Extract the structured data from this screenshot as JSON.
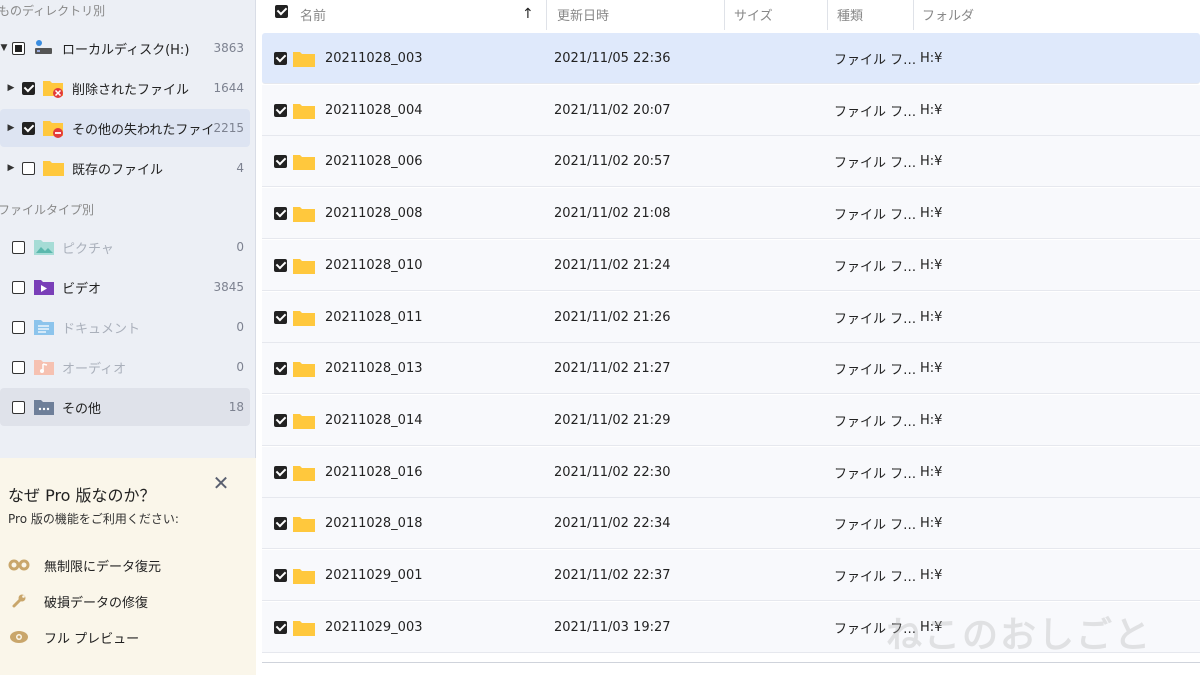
{
  "sidebar": {
    "dir_section_title": "ものディレクトリ別",
    "drive": {
      "label": "ローカルディスク(H:)",
      "count": "3863"
    },
    "dir_items": [
      {
        "label": "削除されたファイル",
        "count": "1644"
      },
      {
        "label": "その他の失われたファイル",
        "count": "2215"
      },
      {
        "label": "既存のファイル",
        "count": "4"
      }
    ],
    "type_section_title": "ファイルタイプ別",
    "type_items": [
      {
        "label": "ピクチャ",
        "count": "0",
        "icon": "picture-icon"
      },
      {
        "label": "ビデオ",
        "count": "3845",
        "icon": "video-icon"
      },
      {
        "label": "ドキュメント",
        "count": "0",
        "icon": "document-icon"
      },
      {
        "label": "オーディオ",
        "count": "0",
        "icon": "audio-icon"
      },
      {
        "label": "その他",
        "count": "18",
        "icon": "other-icon"
      }
    ]
  },
  "pro": {
    "title": "なぜ Pro 版なのか？",
    "subtitle": "Pro 版の機能をご利用ください:",
    "close": "✕",
    "features": [
      {
        "label": "無制限にデータ復元",
        "icon": "infinity-icon"
      },
      {
        "label": "破損データの修復",
        "icon": "wrench-icon"
      },
      {
        "label": "フル プレビュー",
        "icon": "eye-icon"
      }
    ]
  },
  "table": {
    "columns": {
      "name": "名前",
      "sort_arrow": "↑",
      "modified": "更新日時",
      "size": "サイズ",
      "type": "種類",
      "folder": "フォルダ"
    },
    "rows": [
      {
        "name": "20211028_003",
        "modified": "2021/11/05 22:36",
        "size": "",
        "type": "ファイル フ…",
        "folder": "H:¥"
      },
      {
        "name": "20211028_004",
        "modified": "2021/11/02 20:07",
        "size": "",
        "type": "ファイル フ…",
        "folder": "H:¥"
      },
      {
        "name": "20211028_006",
        "modified": "2021/11/02 20:57",
        "size": "",
        "type": "ファイル フ…",
        "folder": "H:¥"
      },
      {
        "name": "20211028_008",
        "modified": "2021/11/02 21:08",
        "size": "",
        "type": "ファイル フ…",
        "folder": "H:¥"
      },
      {
        "name": "20211028_010",
        "modified": "2021/11/02 21:24",
        "size": "",
        "type": "ファイル フ…",
        "folder": "H:¥"
      },
      {
        "name": "20211028_011",
        "modified": "2021/11/02 21:26",
        "size": "",
        "type": "ファイル フ…",
        "folder": "H:¥"
      },
      {
        "name": "20211028_013",
        "modified": "2021/11/02 21:27",
        "size": "",
        "type": "ファイル フ…",
        "folder": "H:¥"
      },
      {
        "name": "20211028_014",
        "modified": "2021/11/02 21:29",
        "size": "",
        "type": "ファイル フ…",
        "folder": "H:¥"
      },
      {
        "name": "20211028_016",
        "modified": "2021/11/02 22:30",
        "size": "",
        "type": "ファイル フ…",
        "folder": "H:¥"
      },
      {
        "name": "20211028_018",
        "modified": "2021/11/02 22:34",
        "size": "",
        "type": "ファイル フ…",
        "folder": "H:¥"
      },
      {
        "name": "20211029_001",
        "modified": "2021/11/02 22:37",
        "size": "",
        "type": "ファイル フ…",
        "folder": "H:¥"
      },
      {
        "name": "20211029_003",
        "modified": "2021/11/03 19:27",
        "size": "",
        "type": "ファイル フ…",
        "folder": "H:¥"
      }
    ]
  },
  "watermark": "ねこのおしごと",
  "colors": {
    "folder": "#ffc83d",
    "selected_row": "#dfe9fb",
    "sidebar_bg": "#eceff5",
    "pro_bg": "#faf6ea"
  }
}
